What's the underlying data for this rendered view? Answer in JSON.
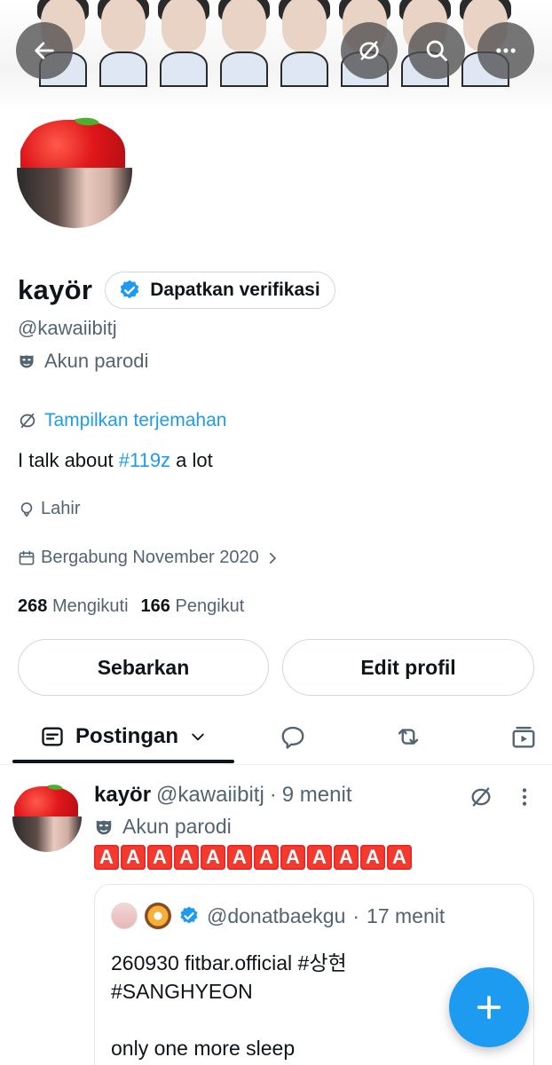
{
  "profile": {
    "display_name": "kayör",
    "verify_label": "Dapatkan verifikasi",
    "handle": "@kawaiibitj",
    "parody_label": "Akun parodi",
    "translate_label": "Tampilkan terjemahan",
    "bio_prefix": "I talk about ",
    "bio_hashtag": "#119z",
    "bio_suffix": " a lot",
    "birth_label": "Lahir",
    "joined_label": "Bergabung November 2020",
    "following_count": "268",
    "following_label": "Mengikuti",
    "followers_count": "166",
    "followers_label": "Pengikut"
  },
  "actions": {
    "share_label": "Sebarkan",
    "edit_label": "Edit profil"
  },
  "tabs": {
    "posts_label": "Postingan"
  },
  "post": {
    "author_name": "kayör",
    "author_handle": "@kawaiibitj",
    "separator": "·",
    "time": "9 menit",
    "parody_label": "Akun parodi",
    "emoji_letters": [
      "A",
      "A",
      "A",
      "A",
      "A",
      "A",
      "A",
      "A",
      "A",
      "A",
      "A",
      "A"
    ]
  },
  "quote": {
    "handle": "@donatbaekgu",
    "separator": "·",
    "time": "17 menit",
    "text": "260930 fitbar.official #상현\n#SANGHYEON\n\nonly one more sleep"
  },
  "icons": {
    "back": "arrow-left-icon",
    "translate": "translate-icon",
    "search": "search-icon",
    "more": "more-icon",
    "verified": "verified-badge-icon",
    "parody": "mask-icon",
    "location": "location-pin-icon",
    "calendar": "calendar-icon",
    "chevron": "chevron-right-icon",
    "compose": "plus-icon"
  },
  "colors": {
    "accent": "#1d9bf0",
    "text": "#0f1419",
    "muted": "#536471"
  }
}
